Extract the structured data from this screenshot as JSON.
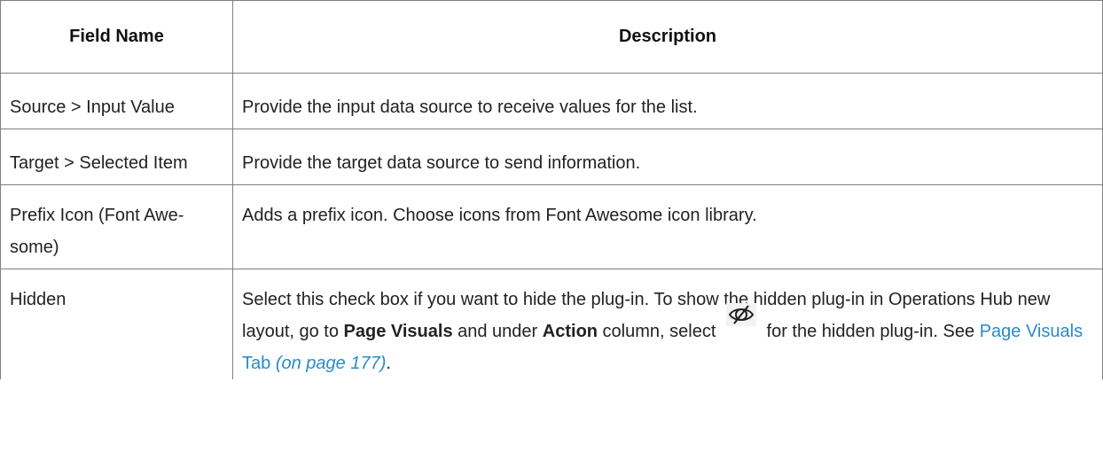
{
  "table": {
    "headers": {
      "field_name": "Field Name",
      "description": "Description"
    },
    "rows": [
      {
        "field": "Source > Input Value",
        "description": "Provide the input data source to receive values for the list."
      },
      {
        "field": "Target > Selected Item",
        "description": "Provide the target data source to send information."
      },
      {
        "field": "Prefix Icon (Font Awe-some)",
        "field_line1": "Prefix Icon (Font Awe-",
        "field_line2": "some)",
        "description": "Adds a prefix icon. Choose icons from Font Awesome icon library."
      },
      {
        "field": "Hidden",
        "description_parts": {
          "part1": "Select this check box if you want to hide the plug-in. To show the hidden plug-in in Operations Hub new layout, go to ",
          "bold1": "Page Visuals",
          "part2": " and under ",
          "bold2": "Action",
          "part3": " column, select ",
          "icon": "eye-slash-icon",
          "part4": " for the hidden plug-in. See ",
          "link_text": "Page Visuals Tab",
          "link_page": "(on page 177)",
          "part5": "."
        }
      }
    ]
  },
  "colors": {
    "link": "#2a8bc7",
    "border": "#7f7f7f"
  }
}
